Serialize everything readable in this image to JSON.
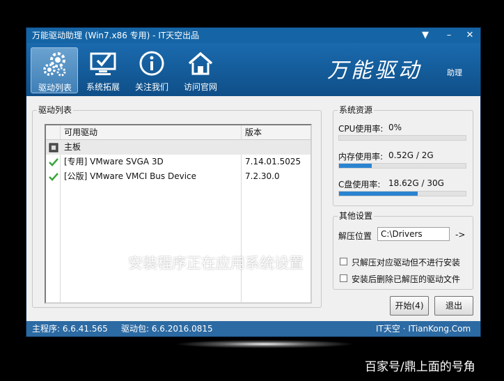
{
  "window": {
    "title": "万能驱动助理 (Win7.x86 专用) - IT天空出品",
    "controls": {
      "menu": "▼",
      "minimize": "–",
      "close": "✕"
    }
  },
  "nav": [
    {
      "label": "驱动列表",
      "icon": "gears-icon",
      "active": true
    },
    {
      "label": "系统拓展",
      "icon": "monitor-check-icon",
      "active": false
    },
    {
      "label": "关注我们",
      "icon": "info-icon",
      "active": false
    },
    {
      "label": "访问官网",
      "icon": "home-icon",
      "active": false
    }
  ],
  "brand": {
    "main": "万能驱动",
    "sub": "助理"
  },
  "driver_list": {
    "group_title": "驱动列表",
    "columns": {
      "name": "可用驱动",
      "version": "版本"
    },
    "rows": [
      {
        "icon": "motherboard-icon",
        "name": "主板",
        "version": ""
      },
      {
        "icon": "check-icon",
        "name": "[专用] VMware SVGA 3D",
        "version": "7.14.01.5025"
      },
      {
        "icon": "check-icon",
        "name": "[公版] VMware VMCI Bus Device",
        "version": "7.2.30.0"
      }
    ]
  },
  "resources": {
    "group_title": "系统资源",
    "cpu": {
      "label": "CPU使用率:",
      "value": "0%",
      "fraction": 0.0
    },
    "memory": {
      "label": "内存使用率:",
      "value": "0.52G / 2G",
      "fraction": 0.26
    },
    "disk": {
      "label": "C盘使用率:",
      "value": "18.62G / 30G",
      "fraction": 0.62
    }
  },
  "settings": {
    "group_title": "其他设置",
    "extract_label": "解压位置",
    "extract_path": "C:\\Drivers",
    "browse": "->",
    "option1": "只解压对应驱动但不进行安装",
    "option2": "安装后删除已解压的驱动文件"
  },
  "buttons": {
    "start": "开始(4)",
    "exit": "退出"
  },
  "status": {
    "main": "主程序: 6.6.41.565",
    "package": "驱动包: 6.6.2016.0815",
    "site": "IT天空 · ITianKong.Com"
  },
  "overlay_text": "安装程序正在应用系统设置",
  "watermark": "百家号/鼎上面的号角",
  "colors": {
    "accent": "#1565a6",
    "progress": "#2b84d0",
    "check": "#3aa53a"
  }
}
